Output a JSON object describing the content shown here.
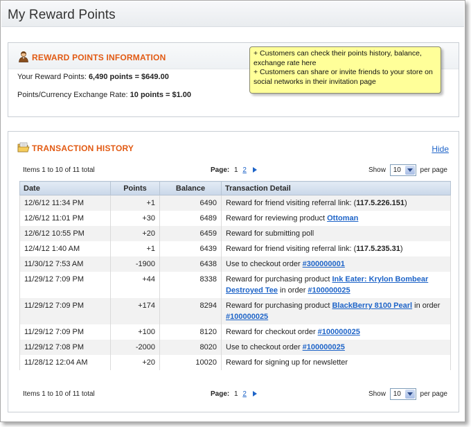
{
  "page": {
    "title": "My Reward Points"
  },
  "info": {
    "heading": "REWARD POINTS INFORMATION",
    "points_label": "Your Reward Points:",
    "points_value": "6,490 points = $649.00",
    "rate_label": "Points/Currency Exchange Rate:",
    "rate_value": "10 points = $1.00"
  },
  "note": {
    "line1": "+ Customers can check their points history, balance, exchange rate here",
    "line2": "+ Customers can share or invite friends to your store on social networks in their invitation page"
  },
  "history": {
    "heading": "TRANSACTION HISTORY",
    "hide_label": "Hide",
    "pager": {
      "items_text": "Items 1 to 10 of 11 total",
      "page_label": "Page:",
      "page_current": "1",
      "page_next": "2",
      "show_label": "Show",
      "per_page_value": "10",
      "per_page_label": "per page"
    },
    "columns": [
      "Date",
      "Points",
      "Balance",
      "Transaction Detail"
    ],
    "rows": [
      {
        "date": "12/6/12 11:34 PM",
        "points": "+1",
        "balance": "6490",
        "detail_text": "Reward for friend visiting referral link: (",
        "detail_bold": "117.5.226.151",
        "detail_after": ")",
        "detail_link": "",
        "detail_tail": "",
        "detail_link2": ""
      },
      {
        "date": "12/6/12 11:01 PM",
        "points": "+30",
        "balance": "6489",
        "detail_text": "Reward for reviewing product ",
        "detail_bold": "",
        "detail_after": "",
        "detail_link": "Ottoman",
        "detail_tail": "",
        "detail_link2": ""
      },
      {
        "date": "12/6/12 10:55 PM",
        "points": "+20",
        "balance": "6459",
        "detail_text": "Reward for submitting poll",
        "detail_bold": "",
        "detail_after": "",
        "detail_link": "",
        "detail_tail": "",
        "detail_link2": ""
      },
      {
        "date": "12/4/12 1:40 AM",
        "points": "+1",
        "balance": "6439",
        "detail_text": "Reward for friend visiting referral link: (",
        "detail_bold": "117.5.235.31",
        "detail_after": ")",
        "detail_link": "",
        "detail_tail": "",
        "detail_link2": ""
      },
      {
        "date": "11/30/12 7:53 AM",
        "points": "-1900",
        "balance": "6438",
        "detail_text": "Use to checkout order ",
        "detail_bold": "",
        "detail_after": "",
        "detail_link": "#300000001",
        "detail_tail": "",
        "detail_link2": ""
      },
      {
        "date": "11/29/12 7:09 PM",
        "points": "+44",
        "balance": "8338",
        "detail_text": "Reward for purchasing product ",
        "detail_bold": "",
        "detail_after": "",
        "detail_link": "Ink Eater: Krylon Bombear Destroyed Tee",
        "detail_tail": " in order ",
        "detail_link2": "#100000025"
      },
      {
        "date": "11/29/12 7:09 PM",
        "points": "+174",
        "balance": "8294",
        "detail_text": "Reward for purchasing product ",
        "detail_bold": "",
        "detail_after": "",
        "detail_link": "BlackBerry 8100 Pearl",
        "detail_tail": " in order ",
        "detail_link2": "#100000025"
      },
      {
        "date": "11/29/12 7:09 PM",
        "points": "+100",
        "balance": "8120",
        "detail_text": "Reward for checkout order ",
        "detail_bold": "",
        "detail_after": "",
        "detail_link": "#100000025",
        "detail_tail": "",
        "detail_link2": ""
      },
      {
        "date": "11/29/12 7:08 PM",
        "points": "-2000",
        "balance": "8020",
        "detail_text": "Use to checkout order ",
        "detail_bold": "",
        "detail_after": "",
        "detail_link": "#100000025",
        "detail_tail": "",
        "detail_link2": ""
      },
      {
        "date": "11/28/12 12:04 AM",
        "points": "+20",
        "balance": "10020",
        "detail_text": "Reward for signing up for newsletter",
        "detail_bold": "",
        "detail_after": "",
        "detail_link": "",
        "detail_tail": "",
        "detail_link2": ""
      }
    ]
  }
}
